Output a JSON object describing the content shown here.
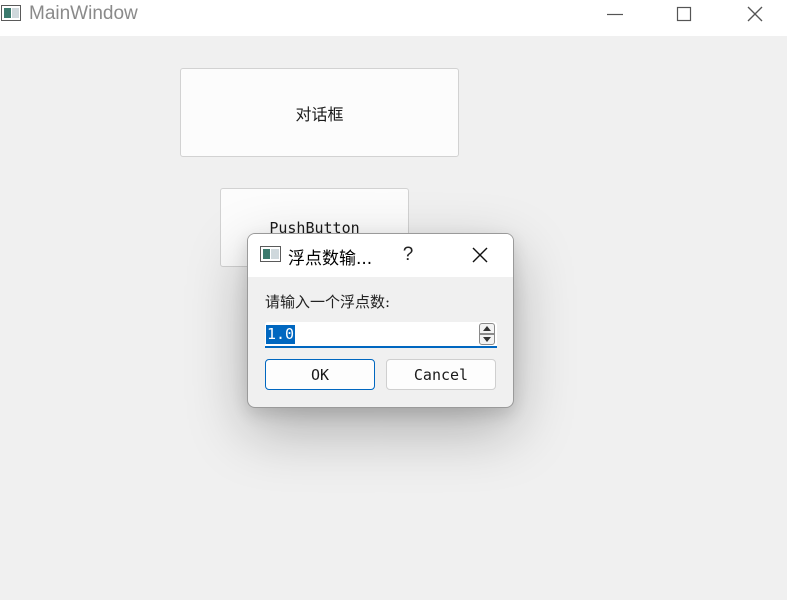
{
  "window": {
    "title": "MainWindow",
    "icon": "app-window-icon",
    "controls": [
      "minimize-icon",
      "maximize-icon",
      "close-icon"
    ]
  },
  "main": {
    "dialog_button_label": "对话框",
    "push_button_label": "PushButton"
  },
  "dialog": {
    "title": "浮点数输...",
    "help_label": "?",
    "prompt": "请输入一个浮点数:",
    "value": "1.0",
    "ok_label": "OK",
    "cancel_label": "Cancel"
  },
  "colors": {
    "accent": "#0067c0",
    "background": "#f0f0f0",
    "titlebar": "#ffffff"
  }
}
